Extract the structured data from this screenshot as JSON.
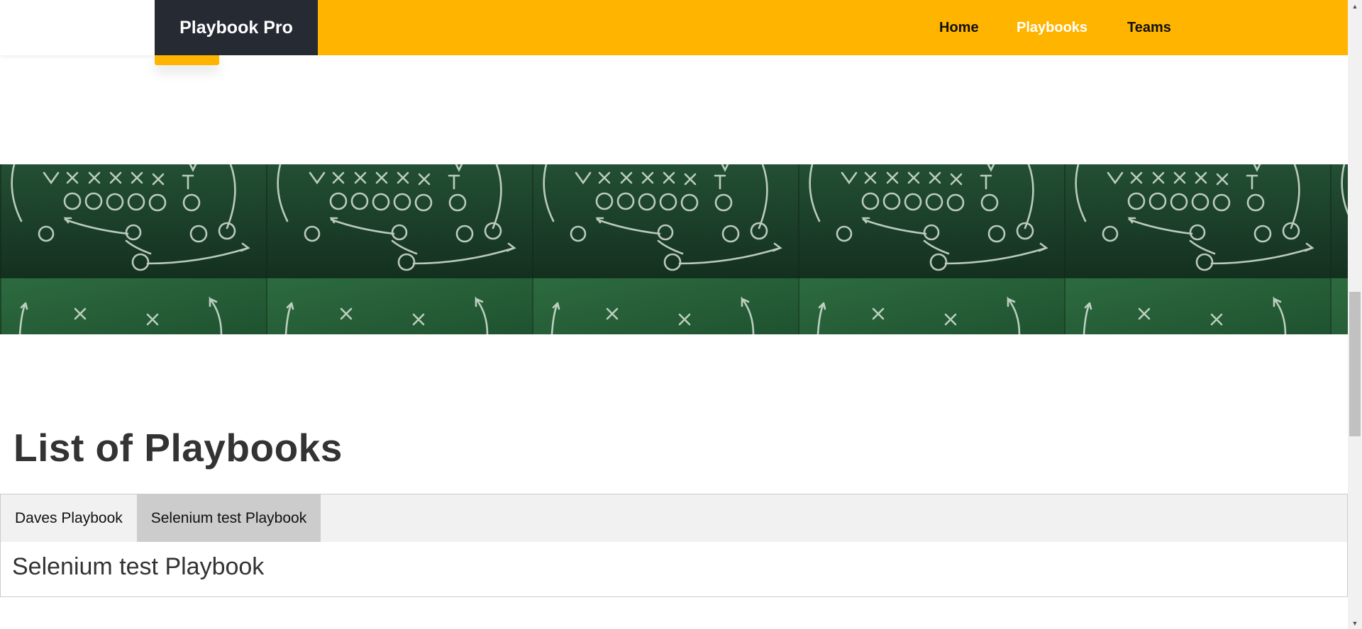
{
  "header": {
    "brand": "Playbook Pro",
    "nav": {
      "home": "Home",
      "playbooks": "Playbooks",
      "teams": "Teams"
    },
    "active_nav": "Playbooks",
    "brand_color": "#252a33",
    "accent_color": "#ffb400"
  },
  "banner": {
    "image": "football-play-chalkboard",
    "background_color": "#1f4f2e"
  },
  "main": {
    "title": "List of Playbooks",
    "tabs": [
      {
        "label": "Daves Playbook",
        "active": false
      },
      {
        "label": "Selenium test Playbook",
        "active": true
      }
    ],
    "panel_heading": "Selenium test Playbook"
  },
  "scrollbar": {
    "up_icon": "scroll-up-arrow-icon",
    "down_icon": "scroll-down-arrow-icon"
  }
}
